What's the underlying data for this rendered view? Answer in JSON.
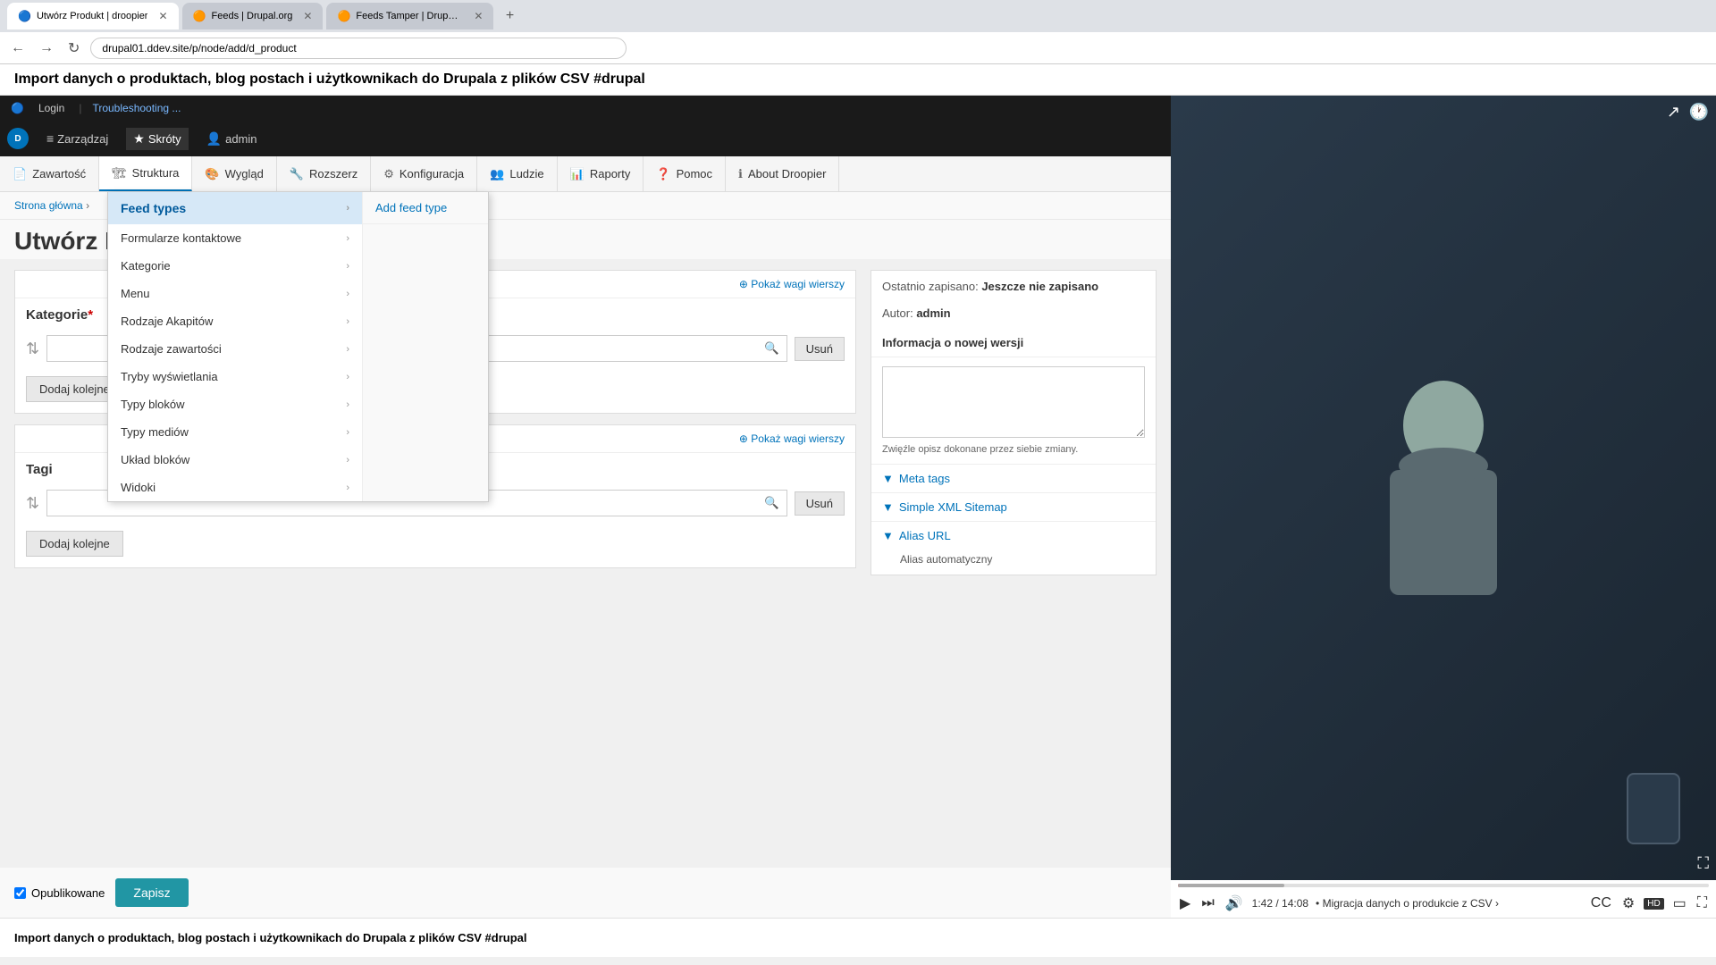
{
  "browser": {
    "tabs": [
      {
        "id": "tab1",
        "label": "Utwórz Produkt | droopier",
        "active": true
      },
      {
        "id": "tab2",
        "label": "Feeds | Drupal.org",
        "active": false
      },
      {
        "id": "tab3",
        "label": "Feeds Tamper | Drupal.org",
        "active": false
      }
    ],
    "address": "drupal01.ddev.site/p/node/add/d_product",
    "nav_back": "←",
    "nav_forward": "→",
    "nav_reload": "↻"
  },
  "yt_title": "Import danych o produktach, blog postach i użytkownikach do Drupala z plików CSV #drupal",
  "yt_bottom": "Import danych o produktach, blog postach i użytkownikach do Drupala z plików CSV #drupal",
  "system_bar": {
    "login": "Login",
    "troubleshooting": "Troubleshooting ..."
  },
  "drupal_toolbar": {
    "logo": "D",
    "items": [
      {
        "label": "Zarządzaj",
        "icon": "≡"
      },
      {
        "label": "Skróty",
        "icon": "★"
      },
      {
        "label": "admin",
        "icon": "👤"
      }
    ]
  },
  "drupal_nav": {
    "items": [
      {
        "label": "Zawartość",
        "icon": "📄"
      },
      {
        "label": "Struktura",
        "icon": "🏗"
      },
      {
        "label": "Wygląd",
        "icon": "🎨"
      },
      {
        "label": "Rozszerz",
        "icon": "🔧"
      },
      {
        "label": "Konfiguracja",
        "icon": "⚙"
      },
      {
        "label": "Ludzie",
        "icon": "👥"
      },
      {
        "label": "Raporty",
        "icon": "📊"
      },
      {
        "label": "Pomoc",
        "icon": "❓"
      },
      {
        "label": "About Droopier",
        "icon": "ℹ"
      }
    ]
  },
  "dropdown": {
    "feed_types_label": "Feed types",
    "add_feed_type_label": "Add feed type",
    "items": [
      {
        "label": "Formularze kontaktowe",
        "has_arrow": true
      },
      {
        "label": "Kategorie",
        "has_arrow": true
      },
      {
        "label": "Menu",
        "has_arrow": true
      },
      {
        "label": "Rodzaje Akapitów",
        "has_arrow": true
      },
      {
        "label": "Rodzaje zawartości",
        "has_arrow": true
      },
      {
        "label": "Tryby wyświetlania",
        "has_arrow": true
      },
      {
        "label": "Typy bloków",
        "has_arrow": true
      },
      {
        "label": "Typy mediów",
        "has_arrow": true
      },
      {
        "label": "Układ bloków",
        "has_arrow": true
      },
      {
        "label": "Widoki",
        "has_arrow": true
      }
    ]
  },
  "breadcrumb": {
    "home": "Strona główna",
    "separator": "›"
  },
  "page": {
    "title": "Utwórz P"
  },
  "form": {
    "kategorie_section": {
      "show_weights": "⊕ Pokaż wagi wierszy",
      "title": "Kategorie",
      "required": "*",
      "search_placeholder": "",
      "remove_btn": "Usuń",
      "add_btn": "Dodaj kolejne"
    },
    "tagi_section": {
      "show_weights": "⊕ Pokaż wagi wierszy",
      "title": "Tagi",
      "search_placeholder": "",
      "remove_btn": "Usuń",
      "add_btn": "Dodaj kolejne"
    },
    "checkbox_label": "Opublikowane",
    "save_btn": "Zapisz"
  },
  "sidebar": {
    "last_saved_label": "Ostatnio zapisano:",
    "last_saved_value": "Jeszcze nie zapisano",
    "author_label": "Autor:",
    "author_value": "admin",
    "new_version_label": "Informacja o nowej wersji",
    "new_version_hint": "Zwięźle opisz dokonane przez siebie zmiany.",
    "meta_tags": "Meta tags",
    "simple_xml": "Simple XML Sitemap",
    "alias_url": "Alias URL",
    "alias_auto": "Alias automatyczny"
  },
  "video": {
    "time_current": "1:42",
    "time_total": "14:08",
    "description": "• Migracja danych o produkcie z CSV  ›",
    "quality": "HD",
    "progress_percent": 12
  }
}
